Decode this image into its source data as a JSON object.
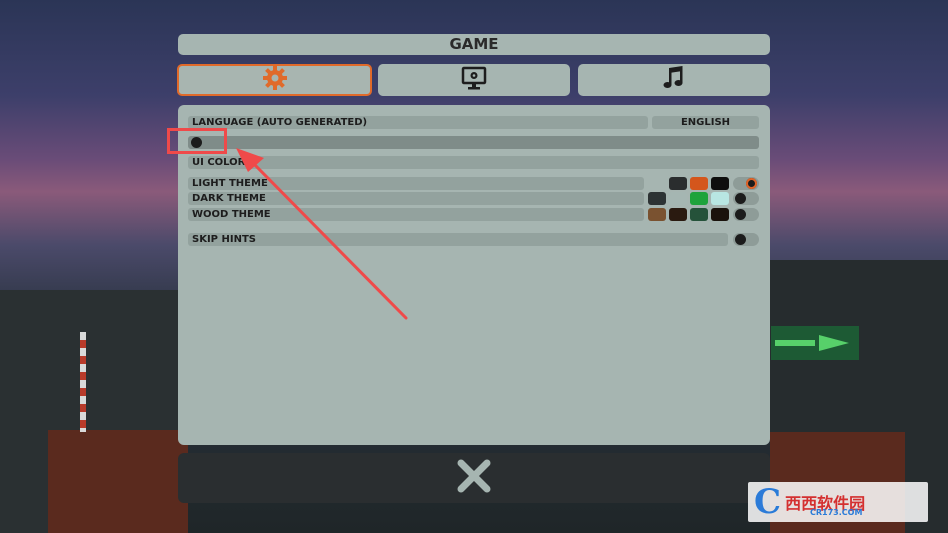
{
  "header": {
    "title": "GAME"
  },
  "tabs": [
    {
      "name": "game-settings",
      "icon": "gear-icon",
      "active": true
    },
    {
      "name": "display-settings",
      "icon": "monitor-gear-icon",
      "active": false
    },
    {
      "name": "audio-settings",
      "icon": "music-note-icon",
      "active": false
    }
  ],
  "settings": {
    "language_label": "LANGUAGE (AUTO GENERATED)",
    "language_value": "ENGLISH",
    "ui_color_label": "UI COLOR",
    "themes": [
      {
        "label": "LIGHT THEME",
        "colors": [
          "#2a2d2e",
          "#d4561c",
          "#0e0e0e"
        ],
        "selected": true
      },
      {
        "label": "DARK THEME",
        "colors": [
          "#2d3334",
          "#a5b6b2",
          "#1ea33c",
          "#b8e6e2"
        ],
        "selected": false
      },
      {
        "label": "WOOD THEME",
        "colors": [
          "#7a5230",
          "#2a1a10",
          "#25523a",
          "#1a120c"
        ],
        "selected": false
      }
    ],
    "skip_hints_label": "SKIP HINTS",
    "slider_value": 0
  },
  "colors": {
    "accent": "#e06a2a",
    "panel": "#a6b5b1",
    "row": "#93a29e",
    "annotation": "#ef4a4a"
  },
  "close": {
    "icon": "close-icon"
  },
  "watermark": {
    "text": "西西软件园",
    "url": "CR173.COM",
    "logo_letter": "C"
  }
}
